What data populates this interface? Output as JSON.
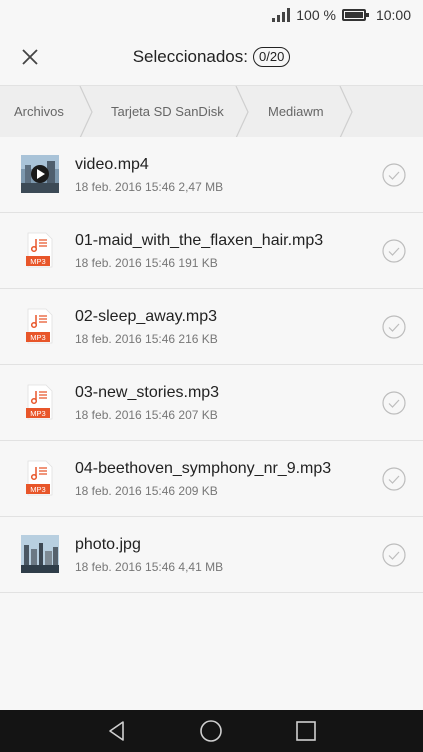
{
  "status": {
    "battery_text": "100 %",
    "time": "10:00"
  },
  "header": {
    "title": "Seleccionados:",
    "count": "0/20"
  },
  "breadcrumb": [
    "Archivos",
    "Tarjeta SD SanDisk",
    "Mediawm"
  ],
  "files": [
    {
      "name": "video.mp4",
      "meta": "18 feb. 2016 15:46 2,47 MB",
      "type": "video-thumbnail"
    },
    {
      "name": "01-maid_with_the_flaxen_hair.mp3",
      "meta": "18 feb. 2016 15:46 191 KB",
      "type": "mp3-file-icon",
      "badge": "MP3"
    },
    {
      "name": "02-sleep_away.mp3",
      "meta": "18 feb. 2016 15:46 216 KB",
      "type": "mp3-file-icon",
      "badge": "MP3"
    },
    {
      "name": "03-new_stories.mp3",
      "meta": "18 feb. 2016 15:46 207 KB",
      "type": "mp3-file-icon",
      "badge": "MP3"
    },
    {
      "name": "04-beethoven_symphony_nr_9.mp3",
      "meta": "18 feb. 2016 15:46 209 KB",
      "type": "mp3-file-icon",
      "badge": "MP3"
    },
    {
      "name": "photo.jpg",
      "meta": "18 feb. 2016 15:46 4,41 MB",
      "type": "photo-thumbnail"
    }
  ],
  "colors": {
    "accent": "#e8562a",
    "background": "#f7f7f7",
    "navbar": "#141414"
  }
}
